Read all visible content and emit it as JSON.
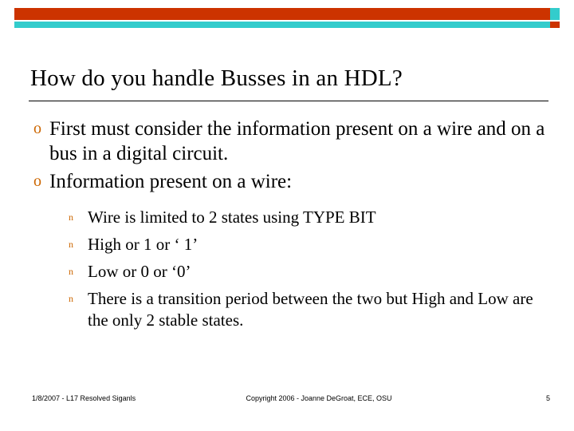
{
  "slide": {
    "title": "How do you handle Busses in an HDL?",
    "bullets": [
      {
        "marker": "o",
        "text": "First must consider the information present on a wire and on a bus in a digital circuit."
      },
      {
        "marker": "o",
        "text": "Information present on a wire:"
      }
    ],
    "sub_bullets": [
      {
        "marker": "n",
        "text": "Wire is limited to 2 states using TYPE BIT"
      },
      {
        "marker": "n",
        "text": "High or 1 or ‘ 1’"
      },
      {
        "marker": "n",
        "text": "Low or 0 or ‘0’"
      },
      {
        "marker": "n",
        "text": "There is a transition period between the two but High and Low are the only 2 stable states."
      }
    ]
  },
  "footer": {
    "left": "1/8/2007 - L17 Resolved Siganls",
    "center": "Copyright 2006 - Joanne DeGroat, ECE, OSU",
    "page_number": "5"
  },
  "colors": {
    "accent_red": "#cc3300",
    "accent_teal": "#33cccc",
    "bullet": "#cc6600"
  }
}
